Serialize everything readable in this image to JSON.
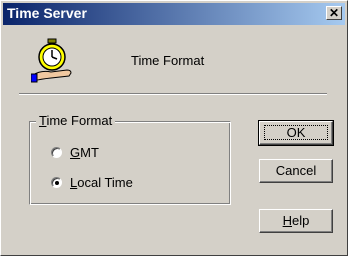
{
  "window": {
    "title": "Time Server"
  },
  "header": {
    "title": "Time Format",
    "icon": "stopwatch-on-hand-icon"
  },
  "group": {
    "legend_key": "T",
    "legend_rest": "ime Format",
    "options": [
      {
        "key": "G",
        "rest": "MT",
        "checked": false
      },
      {
        "key": "L",
        "rest": "ocal Time",
        "checked": true
      }
    ]
  },
  "buttons": {
    "ok": "OK",
    "cancel": "Cancel",
    "help_key": "H",
    "help_rest": "elp"
  },
  "colors": {
    "face": "#d4d0c8",
    "title_start": "#0a246a",
    "title_end": "#a6caf0"
  }
}
